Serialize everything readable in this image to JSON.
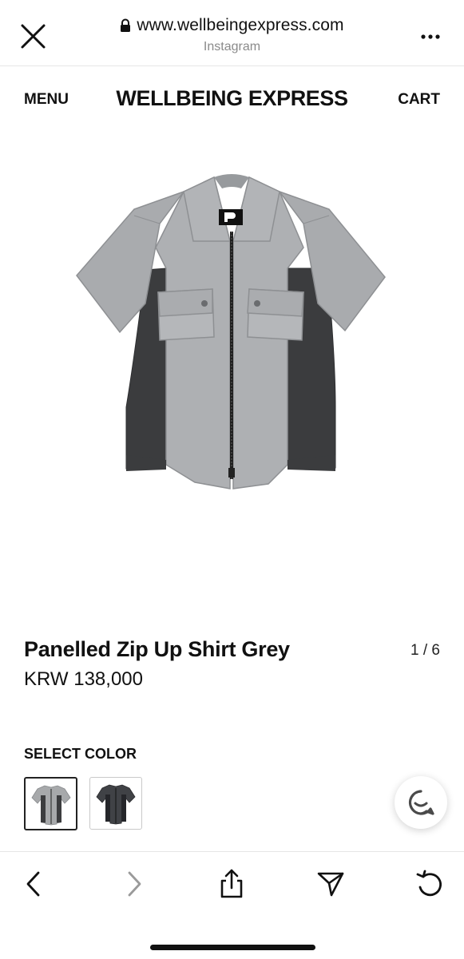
{
  "browser": {
    "url": "www.wellbeingexpress.com",
    "source": "Instagram",
    "icons": {
      "close": "close-icon",
      "lock": "lock-icon",
      "more": "more-icon"
    }
  },
  "header": {
    "menu_label": "MENU",
    "brand": "WELLBEING EXPRESS",
    "cart_label": "CART"
  },
  "product": {
    "name": "Panelled Zip Up Shirt Grey",
    "price": "KRW 138,000",
    "image_pager": "1 / 6",
    "select_color_label": "SELECT COLOR",
    "colors": [
      {
        "name": "Grey",
        "color": "#a7a9ab",
        "panel": "#3c3d3f",
        "selected": true
      },
      {
        "name": "Charcoal",
        "color": "#404246",
        "panel": "#25262a",
        "selected": false
      }
    ]
  },
  "chat": {
    "icon": "chat-icon"
  },
  "bottom_nav": {
    "icons": [
      "back-icon",
      "forward-icon",
      "share-icon",
      "send-icon",
      "reload-icon"
    ]
  },
  "colors": {
    "grey_fabric": "#a9abae",
    "dark_panel": "#3b3c3e",
    "text": "#111111",
    "muted": "#8a8a8a"
  }
}
